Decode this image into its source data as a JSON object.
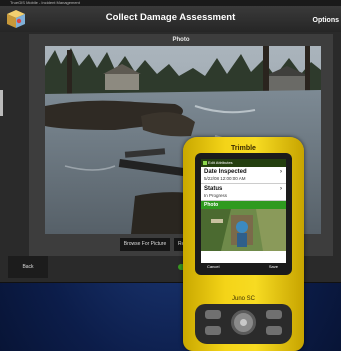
{
  "app": {
    "titlebar_text": "TrueGIS Mobile - Incident Management",
    "title": "Collect Damage Assessment",
    "options_label": "Options",
    "panel_label": "Photo",
    "browse_label": "Browse For Picture",
    "remove_label": "Rem",
    "back_label": "Back"
  },
  "device": {
    "brand": "Trimble",
    "model": "Juno SC",
    "screen": {
      "top_bar_title": "Edit Attributes",
      "rows": [
        {
          "title": "Date Inspected",
          "value": "5/22/08 12:00:00 AM"
        },
        {
          "title": "Status",
          "value": "In Progress"
        }
      ],
      "photo_header": "Photo",
      "cancel_label": "Cancel",
      "save_label": "Save"
    }
  },
  "colors": {
    "device_yellow": "#f4d418",
    "screen_green": "#2f9a1f",
    "background_blue": "#0c1d4a"
  },
  "icons": {
    "app_logo": "map-cube-icon",
    "dpad": "navigation-pad-icon"
  }
}
